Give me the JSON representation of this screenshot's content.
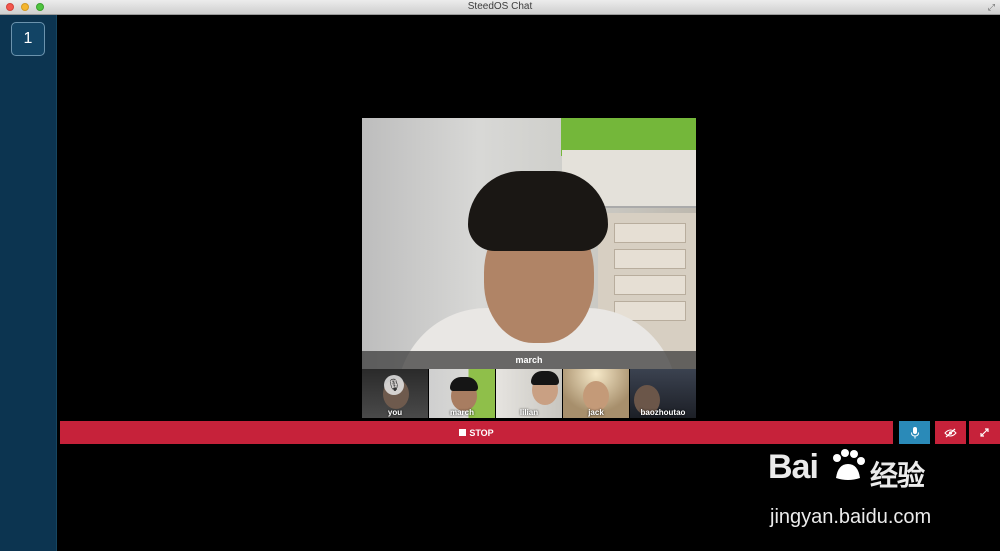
{
  "window": {
    "title": "SteedOS Chat"
  },
  "sidebar": {
    "rooms": [
      {
        "label": "1"
      }
    ]
  },
  "main_video": {
    "name": "march"
  },
  "participants": [
    {
      "name": "you",
      "muted": true
    },
    {
      "name": "march"
    },
    {
      "name": "lilian"
    },
    {
      "name": "jack"
    },
    {
      "name": "baozhoutao"
    }
  ],
  "controls": {
    "stop_label": "STOP",
    "mic_icon": "microphone-icon",
    "camera_icon": "eye-slash-icon",
    "expand_icon": "expand-icon",
    "stop_color": "#c6223a",
    "mic_color": "#2a8ab8"
  },
  "watermark": {
    "brand": "Bai",
    "brand_cn": "经验",
    "url": "jingyan.baidu.com"
  }
}
